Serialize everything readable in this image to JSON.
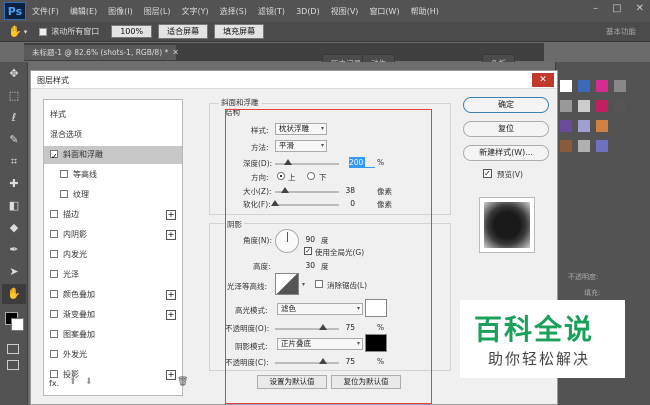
{
  "app": {
    "logo": "Ps",
    "menus": [
      "文件(F)",
      "编辑(E)",
      "图像(I)",
      "图层(L)",
      "文字(Y)",
      "选择(S)",
      "滤镜(T)",
      "3D(D)",
      "视图(V)",
      "窗口(W)",
      "帮助(H)"
    ],
    "win": {
      "min": "–",
      "max": "□",
      "close": "✕"
    }
  },
  "options": {
    "scroll_all": "滚动所有窗口",
    "zoom": "100%",
    "fit": "适合屏幕",
    "fill": "填充屏幕",
    "workspace": "基本功能"
  },
  "doc_tab": "未标题-1 @ 82.6% (shots-1, RGB/8) *",
  "panel_tabs": {
    "history": "历史记录",
    "actions": "动作",
    "swatches": "色板"
  },
  "layers": {
    "opacity": "不透明度:",
    "fill": "填充:"
  },
  "dialog": {
    "title": "图层样式",
    "close": "✕",
    "styles": [
      {
        "label": "样式",
        "checkbox": false,
        "checked": false,
        "plus": false,
        "active": false,
        "indent": false
      },
      {
        "label": "混合选项",
        "checkbox": false,
        "checked": false,
        "plus": false,
        "active": false,
        "indent": false
      },
      {
        "label": "斜面和浮雕",
        "checkbox": true,
        "checked": true,
        "plus": false,
        "active": true,
        "indent": false
      },
      {
        "label": "等高线",
        "checkbox": true,
        "checked": false,
        "plus": false,
        "active": false,
        "indent": true
      },
      {
        "label": "纹理",
        "checkbox": true,
        "checked": false,
        "plus": false,
        "active": false,
        "indent": true
      },
      {
        "label": "描边",
        "checkbox": true,
        "checked": false,
        "plus": true,
        "active": false,
        "indent": false
      },
      {
        "label": "内阴影",
        "checkbox": true,
        "checked": false,
        "plus": true,
        "active": false,
        "indent": false
      },
      {
        "label": "内发光",
        "checkbox": true,
        "checked": false,
        "plus": false,
        "active": false,
        "indent": false
      },
      {
        "label": "光泽",
        "checkbox": true,
        "checked": false,
        "plus": false,
        "active": false,
        "indent": false
      },
      {
        "label": "颜色叠加",
        "checkbox": true,
        "checked": false,
        "plus": true,
        "active": false,
        "indent": false
      },
      {
        "label": "渐变叠加",
        "checkbox": true,
        "checked": false,
        "plus": true,
        "active": false,
        "indent": false
      },
      {
        "label": "图案叠加",
        "checkbox": true,
        "checked": false,
        "plus": false,
        "active": false,
        "indent": false
      },
      {
        "label": "外发光",
        "checkbox": true,
        "checked": false,
        "plus": false,
        "active": false,
        "indent": false
      },
      {
        "label": "投影",
        "checkbox": true,
        "checked": false,
        "plus": true,
        "active": false,
        "indent": false
      }
    ],
    "fx": "fx.",
    "section_title": "斜面和浮雕",
    "structure": {
      "title": "结构",
      "style_label": "样式:",
      "style_value": "枕状浮雕",
      "technique_label": "方法:",
      "technique_value": "平滑",
      "depth_label": "深度(D):",
      "depth_value": "200",
      "depth_level": 0.2,
      "direction_label": "方向:",
      "up": "上",
      "down": "下",
      "size_label": "大小(Z):",
      "size_value": "38",
      "size_level": 0.15,
      "soften_label": "软化(F):",
      "soften_value": "0",
      "soften_level": 0,
      "unit_percent": "%",
      "unit_px": "像素"
    },
    "shading": {
      "title": "阴影",
      "angle_label": "角度(N):",
      "angle_value": "90",
      "deg": "度",
      "global_light": "使用全局光(G)",
      "altitude_label": "高度:",
      "altitude_value": "30",
      "gloss_label": "光泽等高线:",
      "anti_alias": "消除锯齿(L)",
      "highlight_label": "高光模式:",
      "highlight_mode": "滤色",
      "highlight_color": "#ffffff",
      "hopacity_label": "不透明度(O):",
      "hopacity_value": "75",
      "hopacity_level": 0.75,
      "shadow_label": "阴影模式:",
      "shadow_mode": "正片叠底",
      "shadow_color": "#000000",
      "sopacity_label": "不透明度(C):",
      "sopacity_value": "75",
      "sopacity_level": 0.75
    },
    "set_default": "设置为默认值",
    "reset_default": "复位为默认值",
    "ok": "确定",
    "reset": "复位",
    "new_style": "新建样式(W)...",
    "preview": "预览(V)"
  },
  "watermark": {
    "line1": "百科全说",
    "line2": "助你轻松解决"
  }
}
